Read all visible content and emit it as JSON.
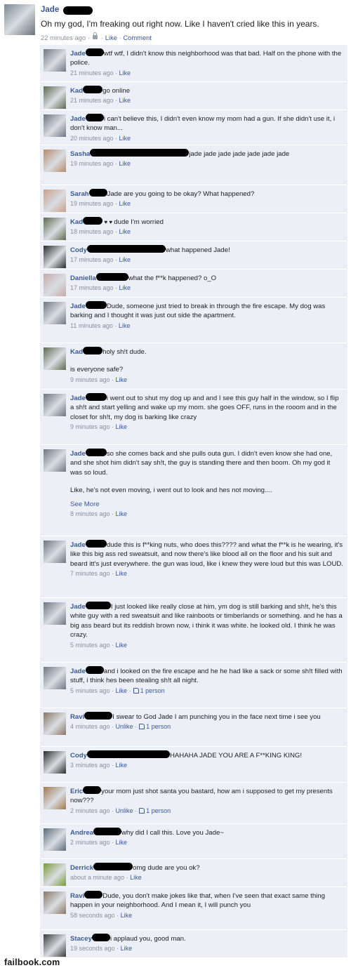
{
  "post": {
    "name": "Jade",
    "message": "Oh my god, I'm freaking out right now. Like I haven't cried like this in years.",
    "time": "22 minutes ago",
    "like": "Like",
    "comment": "Comment",
    "sep": "·"
  },
  "comments": [
    {
      "name": "Jade",
      "text": "wtf wtf, I didn't know this neighborhood was that bad. Half on the phone with the police.",
      "time": "21 minutes ago",
      "action": "Like",
      "avatar": "#6e7680"
    },
    {
      "name": "Kad",
      "text": "go online",
      "time": "21 minutes ago",
      "action": "Like",
      "avatar": "#5e6a4e"
    },
    {
      "name": "Jade",
      "text": "i can't believe this, I didn't even know my mom had a gun. If she didn't use it, i don't know man...",
      "time": "20 minutes ago",
      "action": "Like",
      "avatar": "#6e7680"
    },
    {
      "name": "Sasha",
      "text": "jade jade jade jade jade jade jade",
      "time": "19 minutes ago",
      "action": "Like",
      "avatar": "#b58a6a"
    },
    {
      "name": "Sarah",
      "text": "Jade are you going to be okay? What happened?",
      "time": "19 minutes ago",
      "action": "Like",
      "avatar": "#c9a08a"
    },
    {
      "name": "Kad",
      "text": "dude I'm worried",
      "time": "18 minutes ago",
      "action": "Like",
      "avatar": "#5e6a4e"
    },
    {
      "name": "Cody",
      "text": "what happened Jade!",
      "time": "17 minutes ago",
      "action": "Like",
      "avatar": "#2b2b2b"
    },
    {
      "name": "Daniella",
      "text": "what the f**k happened? o_O",
      "time": "17 minutes ago",
      "action": "Like",
      "avatar": "#c7a9a8"
    },
    {
      "name": "Jade",
      "text": "Dude, someone just tried to break in through the fire escape. My dog was barking and I thought it was just out side the apartment.",
      "time": "11 minutes ago",
      "action": "Like",
      "avatar": "#6e7680"
    },
    {
      "name": "Kad",
      "text": "holy sh!t dude.",
      "text2": "is everyone safe?",
      "time": "9 minutes ago",
      "action": "Like",
      "avatar": "#5e6a4e"
    },
    {
      "name": "Jade",
      "text": "i went out to shut my dog up and and I see this guy half in the window, so I flip a sh!t and start yelling and wake up my mom. she goes OFF, runs in the rooom and in the closet for sh!t, my dog is barking like crazy",
      "time": "9 minutes ago",
      "action": "Like",
      "avatar": "#6e7680"
    },
    {
      "name": "Jade",
      "text": "so she comes back and she pulls outa gun. I didn't even know she had one, and she shot him didn't say sh!t, the guy is standing there and then boom. Oh my god it was so loud.",
      "text2": "Like, he's not even moving, i went out to look and hes not moving....",
      "see_more": "See More",
      "time": "8 minutes ago",
      "action": "Like",
      "avatar": "#6e7680"
    },
    {
      "name": "Jade",
      "text": "dude this is f**king nuts, who does this???? and what the f**k is he wearing, it's like this big ass red sweatsuit, and now there's like blood all on the floor and his suit and beard itt's just everywhere. the gun was loud, like i knew they were loud but this was LOUD.",
      "time": "7 minutes ago",
      "action": "Like",
      "avatar": "#6e7680"
    },
    {
      "name": "Jade",
      "text": "I just looked like really close at him, ym dog is still barking and sh!t, he's this white guy with a red sweatsuit and like rainboots or timberlands or something. and he has a big ass beard but its reddish brown now, i think it was white. he looked old. I think he was crazy.",
      "time": "5 minutes ago",
      "action": "Like",
      "avatar": "#6e7680"
    },
    {
      "name": "Jade",
      "text": "and i looked on the fire escape and he he had like a sack or some sh!t filled with stuff, i think hes been stealing sh!t all night.",
      "time": "5 minutes ago",
      "action": "Like",
      "likes": "1 person",
      "avatar": "#6e7680"
    },
    {
      "name": "Ravi",
      "text": "I swear to God Jade I am punching you in the face next time i see you",
      "time": "4 minutes ago",
      "action": "Unlike",
      "likes": "1 person",
      "avatar": "#8a7565"
    },
    {
      "name": "Cody",
      "text": "HAHAHA JADE YOU ARE A F**KING KING!",
      "time": "3 minutes ago",
      "action": "Like",
      "avatar": "#2b2b2b"
    },
    {
      "name": "Eric",
      "text": "your mom just shot santa you bastard, how am i supposed to get my presents now???",
      "time": "2 minutes ago",
      "action": "Unlike",
      "likes": "1 person",
      "avatar": "#a0784e"
    },
    {
      "name": "Andrea",
      "text": "why did I call this. Love you Jade~",
      "time": "2 minutes ago",
      "action": "Like",
      "avatar": "#5b6b7a"
    },
    {
      "name": "Derrick",
      "text": "omg dude are you ok?",
      "time": "about a minute ago",
      "action": "Like",
      "avatar": "#7a9a3a"
    },
    {
      "name": "Ravi",
      "text": "Dude, you don't make jokes like that, when I've seen that exact same thing happen in your neighborhood. And I mean it, I will punch you",
      "time": "58 seconds ago",
      "action": "Like",
      "avatar": "#8a7565"
    },
    {
      "name": "Stacey",
      "text": "i applaud you, good man.",
      "time": "19 seconds ago",
      "action": "Like",
      "avatar": "#3a3a3a"
    }
  ],
  "footer": {
    "brand": "failbook.com"
  }
}
